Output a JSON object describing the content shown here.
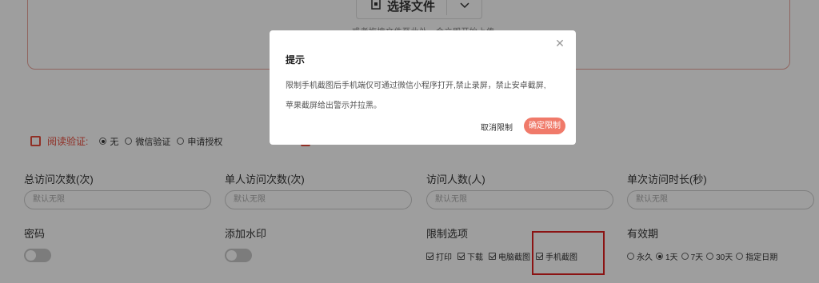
{
  "upload": {
    "choose_label": "选择文件",
    "drag_hint": "或者拖拽文件至此处，会立即开始上传"
  },
  "verify": {
    "label": "阅读验证:",
    "options": [
      "无",
      "微信验证",
      "申请授权"
    ],
    "selected": "无"
  },
  "fields": [
    {
      "label": "总访问次数(次)",
      "placeholder": "默认无限"
    },
    {
      "label": "单人访问次数(次)",
      "placeholder": "默认无限"
    },
    {
      "label": "访问人数(人)",
      "placeholder": "默认无限"
    },
    {
      "label": "单次访问时长(秒)",
      "placeholder": "默认无限"
    }
  ],
  "password": {
    "label": "密码",
    "enabled": false
  },
  "watermark": {
    "label": "添加水印",
    "enabled": false
  },
  "limits": {
    "label": "限制选项",
    "options": [
      "打印",
      "下载",
      "电脑截图",
      "手机截图"
    ]
  },
  "validity": {
    "label": "有效期",
    "options": [
      "永久",
      "1天",
      "7天",
      "30天",
      "指定日期"
    ],
    "selected": "1天"
  },
  "dialog": {
    "title": "提示",
    "body_line1": "限制手机截图后手机端仅可通过微信小程序打开,禁止录屏，禁止安卓截屏,",
    "body_line2": "苹果截屏给出警示并拉黑。",
    "cancel_label": "取消限制",
    "confirm_label": "确定限制",
    "close_icon": "close-icon"
  },
  "colors": {
    "accent": "#f07a6a",
    "warning_red": "#e84c3d",
    "highlight": "#e02020"
  }
}
